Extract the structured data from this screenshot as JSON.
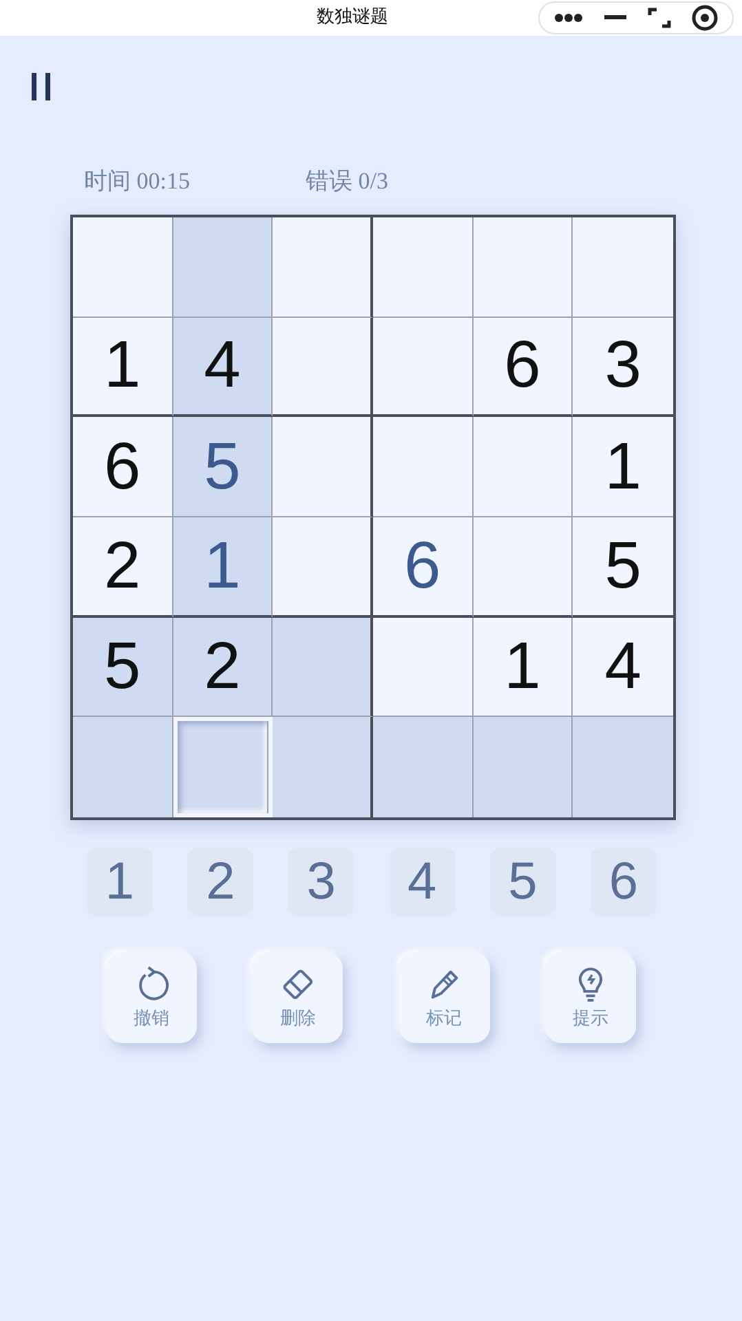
{
  "nav_bar": {
    "title": "数独谜题"
  },
  "stats": {
    "time": "时间 00:15",
    "errors": "错误 0/3"
  },
  "grid": {
    "rows": [
      [
        {
          "highlighted": false,
          "selected": false
        },
        {
          "highlighted": true,
          "selected": false
        },
        {
          "highlighted": false,
          "selected": false
        },
        {
          "highlighted": false,
          "selected": false
        },
        {
          "highlighted": false,
          "selected": false
        },
        {
          "highlighted": false,
          "selected": false
        }
      ],
      [
        {
          "value": "1",
          "kind": "given",
          "highlighted": false,
          "selected": false
        },
        {
          "value": "4",
          "kind": "given",
          "highlighted": true,
          "selected": false
        },
        {
          "highlighted": false,
          "selected": false
        },
        {
          "highlighted": false,
          "selected": false
        },
        {
          "value": "6",
          "kind": "given",
          "highlighted": false,
          "selected": false
        },
        {
          "value": "3",
          "kind": "given",
          "highlighted": false,
          "selected": false
        }
      ],
      [
        {
          "value": "6",
          "kind": "given",
          "highlighted": false,
          "selected": false
        },
        {
          "value": "5",
          "kind": "entered",
          "highlighted": true,
          "selected": false
        },
        {
          "highlighted": false,
          "selected": false
        },
        {
          "highlighted": false,
          "selected": false
        },
        {
          "highlighted": false,
          "selected": false
        },
        {
          "value": "1",
          "kind": "given",
          "highlighted": false,
          "selected": false
        }
      ],
      [
        {
          "value": "2",
          "kind": "given",
          "highlighted": false,
          "selected": false
        },
        {
          "value": "1",
          "kind": "entered",
          "highlighted": true,
          "selected": false
        },
        {
          "highlighted": false,
          "selected": false
        },
        {
          "value": "6",
          "kind": "entered",
          "highlighted": false,
          "selected": false
        },
        {
          "highlighted": false,
          "selected": false
        },
        {
          "value": "5",
          "kind": "given",
          "highlighted": false,
          "selected": false
        }
      ],
      [
        {
          "value": "5",
          "kind": "given",
          "highlighted": true,
          "selected": false
        },
        {
          "value": "2",
          "kind": "given",
          "highlighted": true,
          "selected": false
        },
        {
          "highlighted": true,
          "selected": false
        },
        {
          "highlighted": false,
          "selected": false
        },
        {
          "value": "1",
          "kind": "given",
          "highlighted": false,
          "selected": false
        },
        {
          "value": "4",
          "kind": "given",
          "highlighted": false,
          "selected": false
        }
      ],
      [
        {
          "highlighted": true,
          "selected": false
        },
        {
          "highlighted": true,
          "selected": true
        },
        {
          "highlighted": true,
          "selected": false
        },
        {
          "highlighted": true,
          "selected": false
        },
        {
          "highlighted": true,
          "selected": false
        },
        {
          "highlighted": true,
          "selected": false
        }
      ]
    ]
  },
  "number_pad": [
    "1",
    "2",
    "3",
    "4",
    "5",
    "6"
  ],
  "tools": [
    {
      "kind": "undo",
      "label": "撤销"
    },
    {
      "kind": "erase",
      "label": "删除"
    },
    {
      "kind": "note",
      "label": "标记"
    },
    {
      "kind": "hint",
      "label": "提示"
    }
  ]
}
